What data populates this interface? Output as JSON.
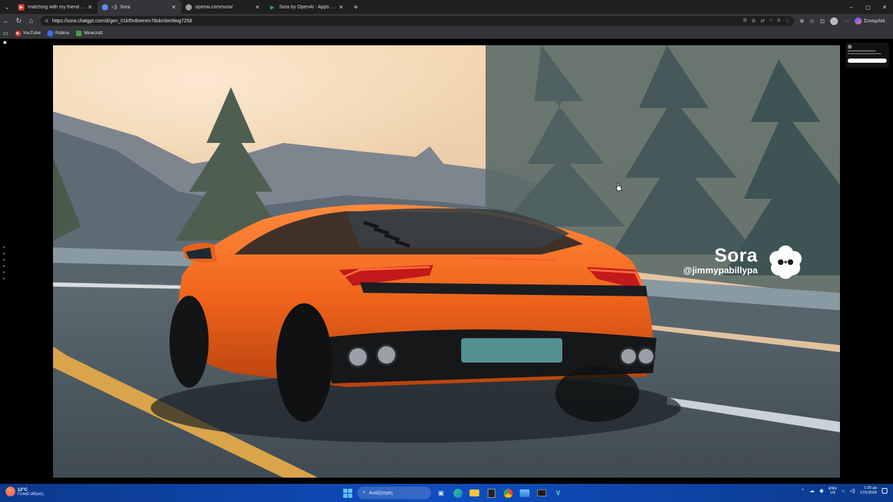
{
  "browser": {
    "tabs": [
      {
        "title": "matching with my friend - YouTube",
        "favicon_color": "#e53935",
        "active": false
      },
      {
        "title": "Sora",
        "favicon_color": "#5b8def",
        "active": true,
        "audio": true
      },
      {
        "title": "openai.com/sora/",
        "favicon_color": "#9e9e9e",
        "active": false
      },
      {
        "title": "Sora by OpenAI - Apps on Google Play",
        "favicon_color": "#34a853",
        "active": false
      }
    ],
    "new_tab": "+",
    "window_controls": {
      "minimize": "–",
      "maximize": "▢",
      "close": "✕"
    },
    "address": "https://sora.chatgpt.com/d/gen_01kf5v8xenen78skmbm9wg7258",
    "copilot_label": "Συνομιλία",
    "bookmarks": [
      {
        "label": "YouTube",
        "color": "#e53935"
      },
      {
        "label": "Roblox",
        "color": "#3b6ee8"
      },
      {
        "label": "Minecraft",
        "color": "#43a047"
      }
    ]
  },
  "video": {
    "watermark_title": "Sora",
    "watermark_handle": "@jimmypabillypa"
  },
  "taskbar": {
    "weather_temp": "12°C",
    "weather_desc": "Γενικά αίθριος",
    "search_placeholder": "Αναζήτηση",
    "lang_top": "ENG",
    "lang_bottom": "US",
    "time": "1:26 μμ",
    "date": "17/1/2026"
  }
}
